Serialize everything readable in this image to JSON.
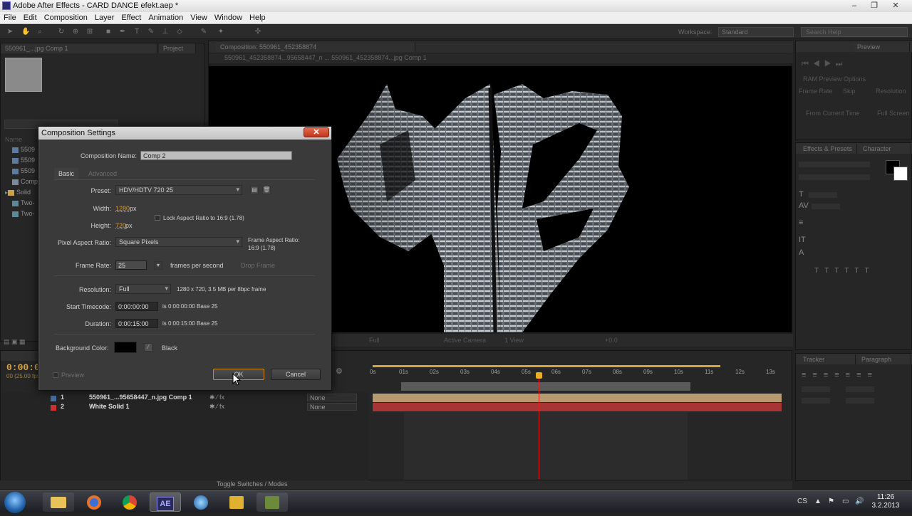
{
  "window": {
    "title": "Adobe After Effects - CARD DANCE efekt.aep *",
    "min": "–",
    "max": "❐",
    "close": "✕"
  },
  "menu": [
    "File",
    "Edit",
    "Composition",
    "Layer",
    "Effect",
    "Animation",
    "View",
    "Window",
    "Help"
  ],
  "toolbar": {
    "workspace_label": "Workspace:",
    "workspace_value": "Standard",
    "search_placeholder": "Search Help"
  },
  "project": {
    "tab": "550961_...jpg Comp 1",
    "tab2": "Project",
    "rows": [
      "5509",
      "5509",
      "5509",
      "Comp",
      "Solid",
      "Two-",
      "Two-"
    ],
    "col": "Name"
  },
  "viewer": {
    "tab": "Composition: 550961_452358874",
    "crumb": "550961_452358874...95658447_n ... 550961_452358874...jpg Comp 1",
    "zoom": "Active Camera",
    "view": "1 View",
    "res": "Full",
    "offset": "+0.0"
  },
  "preview_panel": {
    "tab": "Preview",
    "ram_options": "RAM Preview Options",
    "frame_rate": "Frame Rate",
    "skip": "Skip",
    "resolution": "Resolution",
    "from_current": "From Current Time",
    "full_screen": "Full Screen"
  },
  "char_panel": {
    "tab": "Character",
    "tab2": "Effects & Presets"
  },
  "para_panel": {
    "tab": "Paragraph",
    "tab2": "Tracker"
  },
  "timeline": {
    "timecode": "0:00:0",
    "fps": "00 (25.00 fps)",
    "ticks": [
      "0s",
      "01s",
      "02s",
      "03s",
      "04s",
      "05s",
      "06s",
      "07s",
      "08s",
      "09s",
      "10s",
      "11s",
      "12s",
      "13s"
    ],
    "layers": [
      {
        "num": "1",
        "name": "550961_...95658447_n.jpg Comp 1",
        "parent": "None",
        "color": "#4a6ea0"
      },
      {
        "num": "2",
        "name": "White Solid 1",
        "parent": "None",
        "color": "#cc3030"
      }
    ],
    "toggle": "Toggle Switches / Modes"
  },
  "dialog": {
    "title": "Composition Settings",
    "comp_name_label": "Composition Name:",
    "comp_name": "Comp 2",
    "tab_basic": "Basic",
    "tab_advanced": "Advanced",
    "preset_label": "Preset:",
    "preset": "HDV/HDTV 720 25",
    "width_label": "Width:",
    "width": "1280",
    "height_label": "Height:",
    "height": "720",
    "px": "px",
    "lock_aspect": "Lock Aspect Ratio to 16:9 (1.78)",
    "par_label": "Pixel Aspect Ratio:",
    "par": "Square Pixels",
    "frame_aspect_label": "Frame Aspect Ratio:",
    "frame_aspect": "16:9 (1.78)",
    "fr_label": "Frame Rate:",
    "fr": "25",
    "fps_label": "frames per second",
    "drop_frame": "Drop Frame",
    "res_label": "Resolution:",
    "res": "Full",
    "res_info": "1280 x 720, 3.5 MB per 8bpc frame",
    "start_label": "Start Timecode:",
    "start": "0:00:00:00",
    "start_info": "is 0:00:00:00  Base 25",
    "dur_label": "Duration:",
    "dur": "0:00:15:00",
    "dur_info": "is 0:00:15:00  Base 25",
    "bg_label": "Background Color:",
    "bg_name": "Black",
    "preview": "Preview",
    "ok": "OK",
    "cancel": "Cancel"
  },
  "taskbar": {
    "lang": "CS",
    "time": "11:26",
    "date": "3.2.2013",
    "ae": "AE"
  }
}
